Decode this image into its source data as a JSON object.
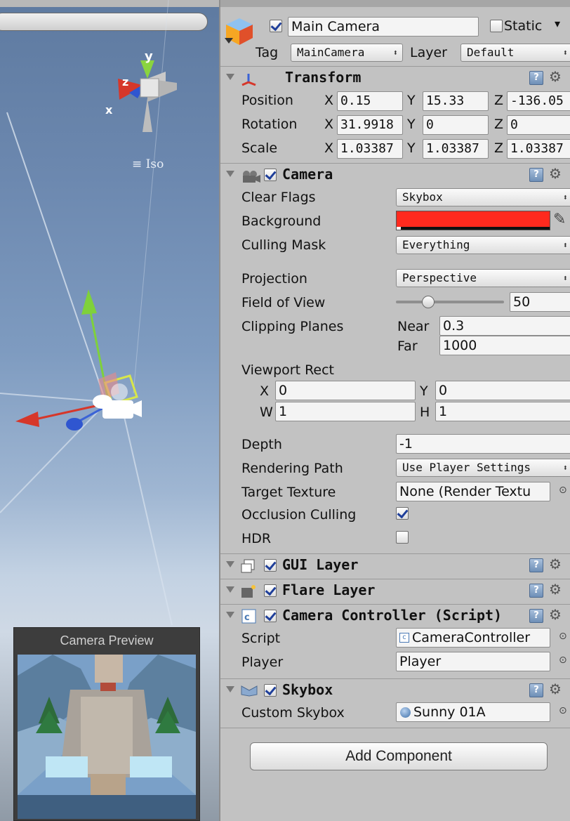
{
  "scene": {
    "iso_label": "Iso",
    "axis_x": "x",
    "axis_y": "y",
    "axis_z": "z"
  },
  "camera_preview": {
    "title": "Camera Preview"
  },
  "object_header": {
    "name": "Main Camera",
    "active": true,
    "static_label": "Static",
    "static": false,
    "tag_label": "Tag",
    "tag_value": "MainCamera",
    "layer_label": "Layer",
    "layer_value": "Default"
  },
  "transform": {
    "title": "Transform",
    "position": {
      "label": "Position",
      "x": "0.15",
      "y": "15.33",
      "z": "-136.05"
    },
    "rotation": {
      "label": "Rotation",
      "x": "31.9918",
      "y": "0",
      "z": "0"
    },
    "scale": {
      "label": "Scale",
      "x": "1.03387",
      "y": "1.03387",
      "z": "1.03387"
    },
    "x_label": "X",
    "y_label": "Y",
    "z_label": "Z"
  },
  "camera": {
    "title": "Camera",
    "enabled": true,
    "clear_flags": {
      "label": "Clear Flags",
      "value": "Skybox"
    },
    "background": {
      "label": "Background",
      "color": "#ff2a1e"
    },
    "culling_mask": {
      "label": "Culling Mask",
      "value": "Everything"
    },
    "projection": {
      "label": "Projection",
      "value": "Perspective"
    },
    "field_of_view": {
      "label": "Field of View",
      "value": "50",
      "slider_fraction": 0.27
    },
    "clipping_planes": {
      "label": "Clipping Planes",
      "near_label": "Near",
      "near": "0.3",
      "far_label": "Far",
      "far": "1000"
    },
    "viewport_rect": {
      "label": "Viewport Rect",
      "x_label": "X",
      "x": "0",
      "y_label": "Y",
      "y": "0",
      "w_label": "W",
      "w": "1",
      "h_label": "H",
      "h": "1"
    },
    "depth": {
      "label": "Depth",
      "value": "-1"
    },
    "rendering_path": {
      "label": "Rendering Path",
      "value": "Use Player Settings"
    },
    "target_texture": {
      "label": "Target Texture",
      "value": "None (Render Textu"
    },
    "occlusion_culling": {
      "label": "Occlusion Culling",
      "checked": true
    },
    "hdr": {
      "label": "HDR",
      "checked": false
    }
  },
  "gui_layer": {
    "title": "GUI Layer",
    "enabled": true
  },
  "flare_layer": {
    "title": "Flare Layer",
    "enabled": true
  },
  "camera_controller": {
    "title": "Camera Controller (Script)",
    "enabled": true,
    "script": {
      "label": "Script",
      "value": "CameraController"
    },
    "player": {
      "label": "Player",
      "value": "Player"
    }
  },
  "skybox": {
    "title": "Skybox",
    "enabled": true,
    "custom_skybox": {
      "label": "Custom Skybox",
      "value": "Sunny 01A"
    }
  },
  "add_component_label": "Add Component",
  "colors": {
    "inspector_bg": "#c2c2c2",
    "axis_red": "#d6372a",
    "axis_green": "#7fd13b",
    "axis_blue": "#3b63d6",
    "checkmark": "#1f3f9a"
  }
}
